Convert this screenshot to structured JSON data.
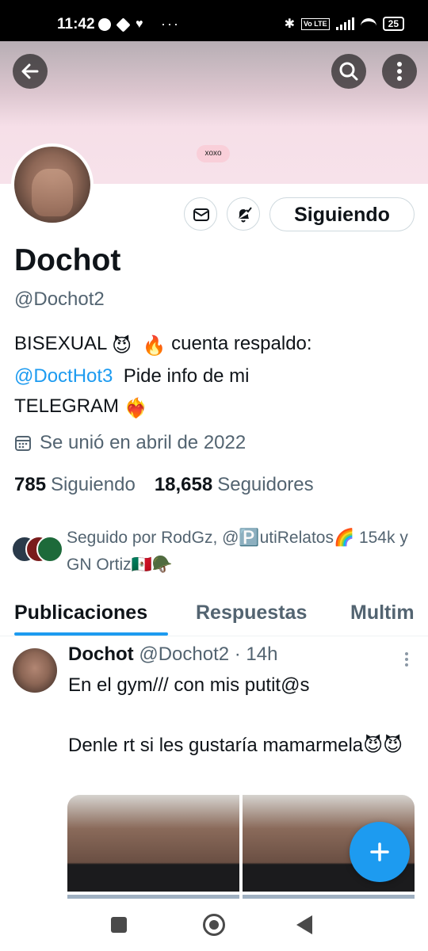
{
  "status_bar": {
    "time": "11:42",
    "more": "···",
    "volte": "Vo LTE",
    "battery": "25"
  },
  "banner": {
    "chip_text": "xoxo"
  },
  "profile": {
    "name": "Dochot",
    "handle": "@Dochot2",
    "follow_label": "Siguiendo",
    "bio_line1_a": "BISEXUAL",
    "bio_line1_emoji1": "😈",
    "bio_line1_emoji2": "🔥",
    "bio_line1_b": "cuenta respaldo:",
    "bio_link": "@DoctHot3",
    "bio_line2_b": "Pide info de mi",
    "bio_line3": "TELEGRAM",
    "bio_line3_emoji": "❤️‍🔥",
    "joined": "Se unió en abril de 2022",
    "following_count": "785",
    "following_label": "Siguiendo",
    "followers_count": "18,658",
    "followers_label": "Seguidores",
    "followed_by": "Seguido por RodGz, @🅿️utiRelatos🌈 154k y GN Ortiz🇲🇽🪖"
  },
  "tabs": [
    {
      "label": "Publicaciones"
    },
    {
      "label": "Respuestas"
    },
    {
      "label": "Multim"
    }
  ],
  "post": {
    "name": "Dochot",
    "meta": "@Dochot2 · 14h",
    "text": "En el gym/// con mis putit@s\n\nDenle rt si les gustaría mamarmela😈😈"
  },
  "colors": {
    "accent": "#1d9bf0",
    "secondary_text": "#536471",
    "primary_text": "#0f1419"
  },
  "icons": [
    "back-arrow-icon",
    "search-icon",
    "more-vertical-icon",
    "mail-icon",
    "bell-check-icon",
    "calendar-icon",
    "plus-icon"
  ]
}
